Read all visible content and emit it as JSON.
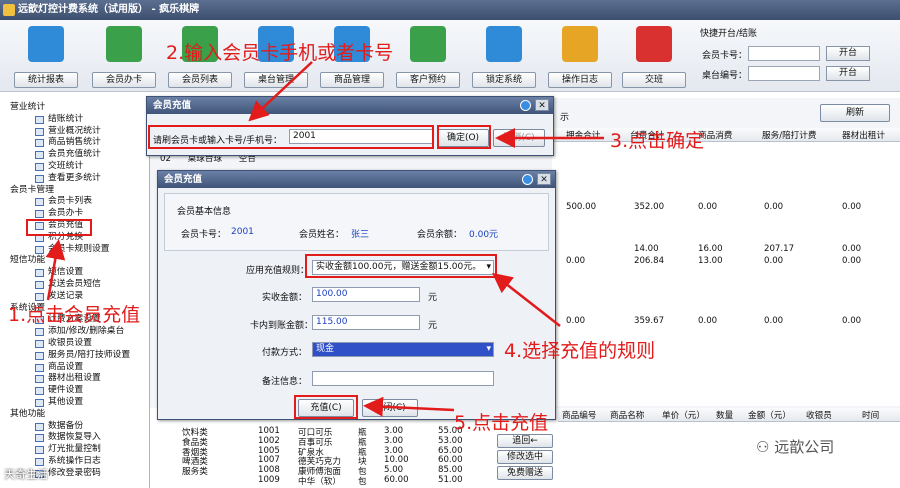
{
  "window": {
    "title": "远歆灯控计费系统（试用版） - 疯乐棋牌"
  },
  "toolbar": {
    "items": [
      {
        "label": "统计报表",
        "icon": "bar-chart-icon",
        "color": "#2f8ad8"
      },
      {
        "label": "会员办卡",
        "icon": "add-user-icon",
        "color": "#3aa04a"
      },
      {
        "label": "会员列表",
        "icon": "member-list-icon",
        "color": "#3aa04a"
      },
      {
        "label": "桌台管理",
        "icon": "table-icon",
        "color": "#2f8ad8"
      },
      {
        "label": "商品管理",
        "icon": "cart-icon",
        "color": "#2f8ad8"
      },
      {
        "label": "客户预约",
        "icon": "customer-icon",
        "color": "#3aa04a"
      },
      {
        "label": "锁定系统",
        "icon": "lock-icon",
        "color": "#2f8ad8"
      },
      {
        "label": "操作日志",
        "icon": "clipboard-icon",
        "color": "#e7a526"
      },
      {
        "label": "交班",
        "icon": "shift-icon",
        "color": "#d93030"
      }
    ]
  },
  "quick": {
    "title": "快捷开台/结账",
    "card_label": "会员卡号：",
    "table_label": "桌台编号：",
    "open_label": "开台"
  },
  "tree": [
    {
      "type": "grp",
      "label": "营业统计"
    },
    {
      "type": "item",
      "label": "结账统计"
    },
    {
      "type": "item",
      "label": "营业概况统计"
    },
    {
      "type": "item",
      "label": "商品销售统计"
    },
    {
      "type": "item",
      "label": "会员充值统计"
    },
    {
      "type": "item",
      "label": "交班统计"
    },
    {
      "type": "item",
      "label": "查看更多统计"
    },
    {
      "type": "grp",
      "label": "会员卡管理"
    },
    {
      "type": "item",
      "label": "会员卡列表"
    },
    {
      "type": "item",
      "label": "会员办卡"
    },
    {
      "type": "item",
      "label": "会员充值"
    },
    {
      "type": "item",
      "label": "积分兑换"
    },
    {
      "type": "item",
      "label": "会员卡规则设置"
    },
    {
      "type": "grp",
      "label": "短信功能"
    },
    {
      "type": "item",
      "label": "短信设置"
    },
    {
      "type": "item",
      "label": "发送会员短信"
    },
    {
      "type": "item",
      "label": "发送记录"
    },
    {
      "type": "grp",
      "label": "系统设置"
    },
    {
      "type": "item",
      "label": "计费方案设置"
    },
    {
      "type": "item",
      "label": "添加/修改/删除桌台"
    },
    {
      "type": "item",
      "label": "收银员设置"
    },
    {
      "type": "item",
      "label": "服务员/陪打技师设置"
    },
    {
      "type": "item",
      "label": "商品设置"
    },
    {
      "type": "item",
      "label": "器材出租设置"
    },
    {
      "type": "item",
      "label": "硬件设置"
    },
    {
      "type": "item",
      "label": "其他设置"
    },
    {
      "type": "grp",
      "label": "其他功能"
    },
    {
      "type": "item",
      "label": "数据备份"
    },
    {
      "type": "item",
      "label": "数据恢复导入"
    },
    {
      "type": "item",
      "label": "灯光批量控制"
    },
    {
      "type": "item",
      "label": "系统操作日志"
    },
    {
      "type": "item",
      "label": "修改登录密码"
    }
  ],
  "main": {
    "refresh_label": "刷新",
    "show_label": "示",
    "headers": [
      "押金合计",
      "台费合计",
      "商品消费",
      "服务/陪打计费",
      "器材出租计"
    ],
    "row_partial": [
      "02",
      "桌球台球",
      "空台"
    ],
    "rows": [
      [
        "500.00",
        "352.00",
        "0.00",
        "0.00",
        "0.00"
      ],
      [
        "",
        "14.00",
        "16.00",
        "207.17",
        "0.00"
      ],
      [
        "0.00",
        "206.84",
        "13.00",
        "0.00",
        "0.00"
      ],
      [
        "0.00",
        "359.67",
        "0.00",
        "0.00",
        "0.00"
      ]
    ]
  },
  "lower": {
    "headers": [
      "商品编号",
      "商品名称",
      "单价（元）",
      "数量",
      "金额（元）",
      "收银员",
      "时间"
    ],
    "buttons": [
      "追回←",
      "修改选中",
      "免费赠送"
    ],
    "products": [
      {
        "cat": "饮料类",
        "code": "1001",
        "name": "可口可乐",
        "unit": "瓶",
        "price": "3.00",
        "amt": "55.00"
      },
      {
        "cat": "食品类",
        "code": "1002",
        "name": "百事可乐",
        "unit": "瓶",
        "price": "3.00",
        "amt": "53.00"
      },
      {
        "cat": "香烟类",
        "code": "1005",
        "name": "矿泉水",
        "unit": "瓶",
        "price": "3.00",
        "amt": "65.00"
      },
      {
        "cat": "啤酒类",
        "code": "1007",
        "name": "德芙巧克力",
        "unit": "块",
        "price": "10.00",
        "amt": "60.00"
      },
      {
        "cat": "服务类",
        "code": "1008",
        "name": "康师傅泡面",
        "unit": "包",
        "price": "5.00",
        "amt": "85.00"
      },
      {
        "cat": "",
        "code": "1009",
        "name": "中华（软）",
        "unit": "包",
        "price": "60.00",
        "amt": "51.00"
      }
    ]
  },
  "dialog1": {
    "title": "会员充值",
    "prompt": "请刷会员卡或输入卡号/手机号：",
    "input_value": "2001",
    "ok_label": "确定(O)",
    "cancel_label": "取消(C)"
  },
  "dialog2": {
    "title": "会员充值",
    "section": "会员基本信息",
    "card_label": "会员卡号：",
    "card_value": "2001",
    "name_label": "会员姓名：",
    "name_value": "张三",
    "balance_label": "会员余额：",
    "balance_value": "0.00元",
    "rule_label": "应用充值规则：",
    "rule_value": "实收金额100.00元，赠送金额15.00元。",
    "received_label": "实收金额：",
    "received_value": "100.00",
    "card_amount_label": "卡内到账金额：",
    "card_amount_value": "115.00",
    "unit": "元",
    "pay_label": "付款方式：",
    "pay_value": "现金",
    "note_label": "备注信息：",
    "recharge_label": "充值(C)",
    "close_label": "关闭(C)"
  },
  "annotations": {
    "a1": "1.点击会员充值",
    "a2": "2.输入会员卡手机或者卡号",
    "a3": "3.点击确定",
    "a4": "4.选择充值的规则",
    "a5": "5.点击充值"
  },
  "watermarks": {
    "brand": "远歆公司",
    "corner": "天奇生活"
  },
  "colors": {
    "annotation": "#e21b1b",
    "title_bar": "#3d4f6e",
    "selection": "#3050c8"
  }
}
